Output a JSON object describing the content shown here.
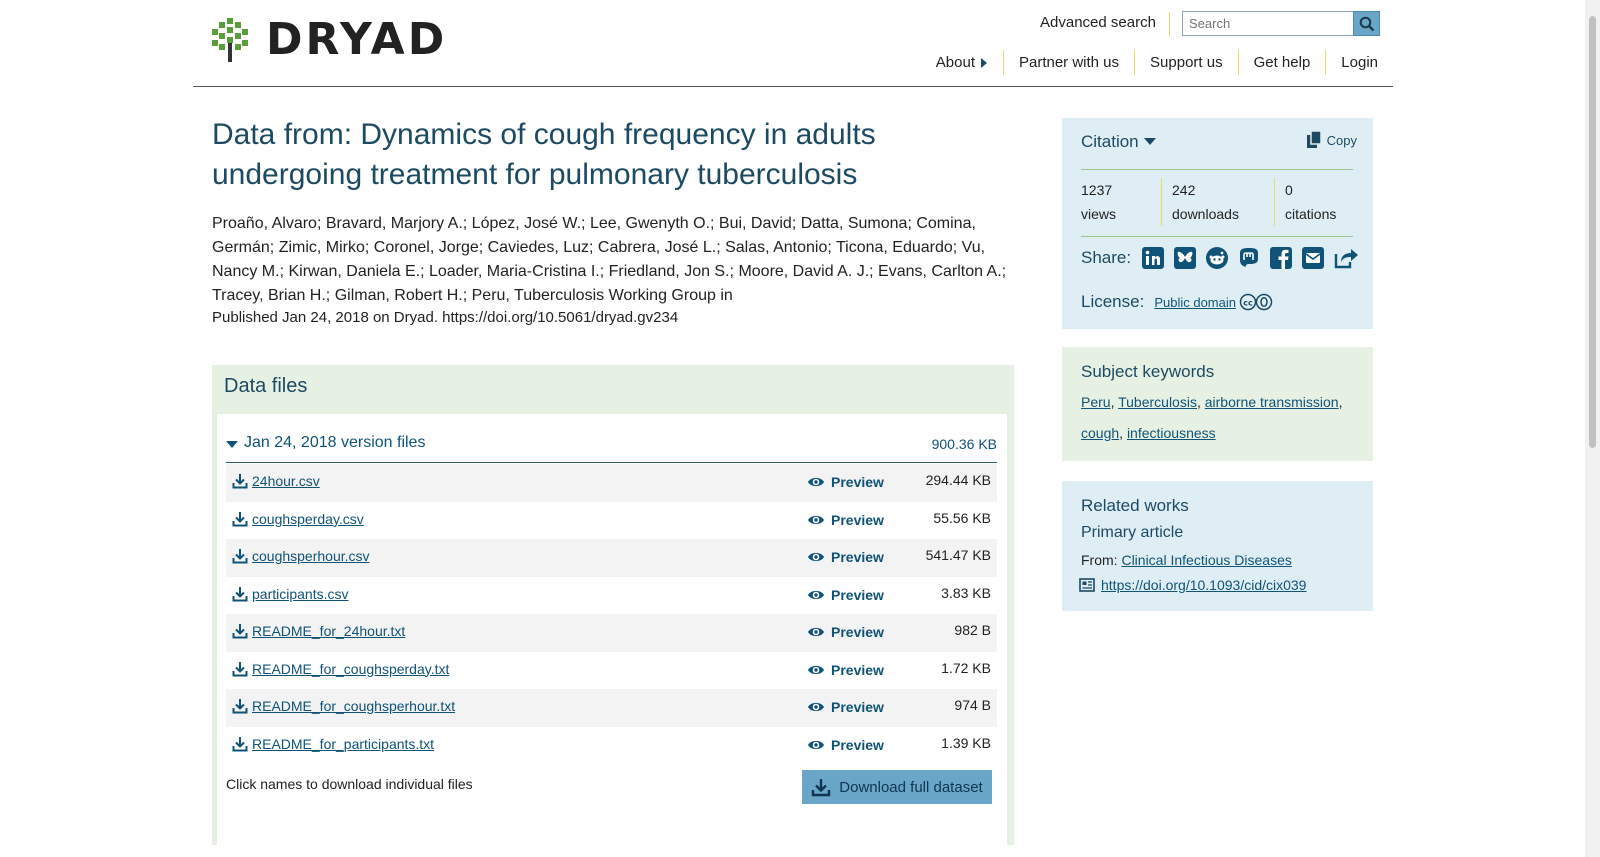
{
  "header": {
    "logo_text": "DRYAD",
    "advanced_search": "Advanced search",
    "search_placeholder": "Search",
    "nav": [
      "About",
      "Partner with us",
      "Support us",
      "Get help",
      "Login"
    ]
  },
  "dataset": {
    "title": "Data from: Dynamics of cough frequency in adults undergoing treatment for pulmonary tuberculosis",
    "authors": "Proaño, Alvaro; Bravard, Marjory A.; López, José W.; Lee, Gwenyth O.; Bui, David; Datta, Sumona; Comina, Germán; Zimic, Mirko; Coronel, Jorge; Caviedes, Luz; Cabrera, José L.; Salas, Antonio; Ticona, Eduardo; Vu, Nancy M.; Kirwan, Daniela E.; Loader, Maria-Cristina I.; Friedland, Jon S.; Moore, David A. J.; Evans, Carlton A.; Tracey, Brian H.; Gilman, Robert H.; Peru, Tuberculosis Working Group in",
    "published": "Published Jan 24, 2018 on Dryad. https://doi.org/10.5061/dryad.gv234"
  },
  "data_files": {
    "title": "Data files",
    "version_label": "Jan 24, 2018 version files",
    "version_size": "900.36 KB",
    "preview_label": "Preview",
    "files": [
      {
        "name": "24hour.csv",
        "size": "294.44 KB"
      },
      {
        "name": "coughsperday.csv",
        "size": "55.56 KB"
      },
      {
        "name": "coughsperhour.csv",
        "size": "541.47 KB"
      },
      {
        "name": "participants.csv",
        "size": "3.83 KB"
      },
      {
        "name": "README_for_24hour.txt",
        "size": "982 B"
      },
      {
        "name": "README_for_coughsperday.txt",
        "size": "1.72 KB"
      },
      {
        "name": "README_for_coughsperhour.txt",
        "size": "974 B"
      },
      {
        "name": "README_for_participants.txt",
        "size": "1.39 KB"
      }
    ],
    "footer_note": "Click names to download individual files",
    "download_full": "Download full dataset"
  },
  "citation": {
    "label": "Citation",
    "copy": "Copy",
    "stats": [
      {
        "num": "1237",
        "label": "views"
      },
      {
        "num": "242",
        "label": "downloads"
      },
      {
        "num": "0",
        "label": "citations"
      }
    ],
    "share_label": "Share:",
    "share_icons": [
      "linkedin-icon",
      "bluesky-icon",
      "reddit-icon",
      "mastodon-icon",
      "facebook-icon",
      "email-icon",
      "share-icon"
    ],
    "license_label": "License:",
    "license_link": "Public domain"
  },
  "keywords": {
    "title": "Subject keywords",
    "items": [
      "Peru",
      "Tuberculosis",
      "airborne transmission",
      "cough",
      "infectiousness"
    ]
  },
  "related": {
    "title": "Related works",
    "subtitle": "Primary article",
    "from_label": "From:",
    "from_link": "Clinical Infectious Diseases",
    "doi": "https://doi.org/10.1093/cid/cix039"
  },
  "colors": {
    "brand": "#1c4a63",
    "link": "#0f5378",
    "accent_blue": "#6aa6c8",
    "panel_green": "#e7f1e3",
    "panel_blue": "#dfeef5",
    "divider_yellow": "#e5dc6a"
  }
}
